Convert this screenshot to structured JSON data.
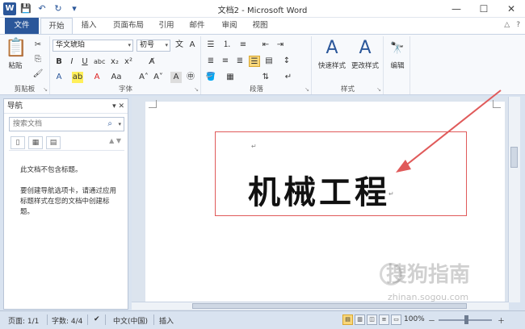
{
  "window": {
    "title": "文档2 - Microsoft Word",
    "app_icon": "W",
    "controls": [
      "—",
      "☐",
      "✕"
    ]
  },
  "qat": {
    "icons": [
      "save-icon",
      "undo-icon",
      "redo-icon",
      "customize-icon"
    ],
    "glyphs": [
      "💾",
      "↶",
      "↻",
      "▾"
    ]
  },
  "tabs": {
    "file": "文件",
    "items": [
      "开始",
      "插入",
      "页面布局",
      "引用",
      "邮件",
      "审阅",
      "视图"
    ],
    "active": "开始"
  },
  "ribbon": {
    "clipboard": {
      "label": "剪贴板",
      "paste": "粘贴"
    },
    "font": {
      "label": "字体",
      "font_name": "华文琥珀",
      "font_size": "初号"
    },
    "paragraph": {
      "label": "段落"
    },
    "styles": {
      "label": "样式",
      "quick_styles": "快速样式",
      "change_styles": "更改样式"
    },
    "editing": {
      "label": "编辑"
    }
  },
  "nav": {
    "title": "导航",
    "search_placeholder": "搜索文档",
    "message1": "此文档不包含标题。",
    "message2": "要创建导航选项卡，请通过应用标题样式在您的文档中创建标题。"
  },
  "document": {
    "text": "机械工程"
  },
  "status": {
    "page": "页面: 1/1",
    "words": "字数: 4/4",
    "language": "中文(中国)",
    "mode": "插入",
    "zoom": "100%",
    "zoom_minus": "－",
    "zoom_plus": "＋"
  },
  "watermark": {
    "text": "搜狗指南",
    "url": "zhinan.sogou.com"
  },
  "colors": {
    "accent": "#2b579a",
    "annotation": "#e05a5a"
  }
}
